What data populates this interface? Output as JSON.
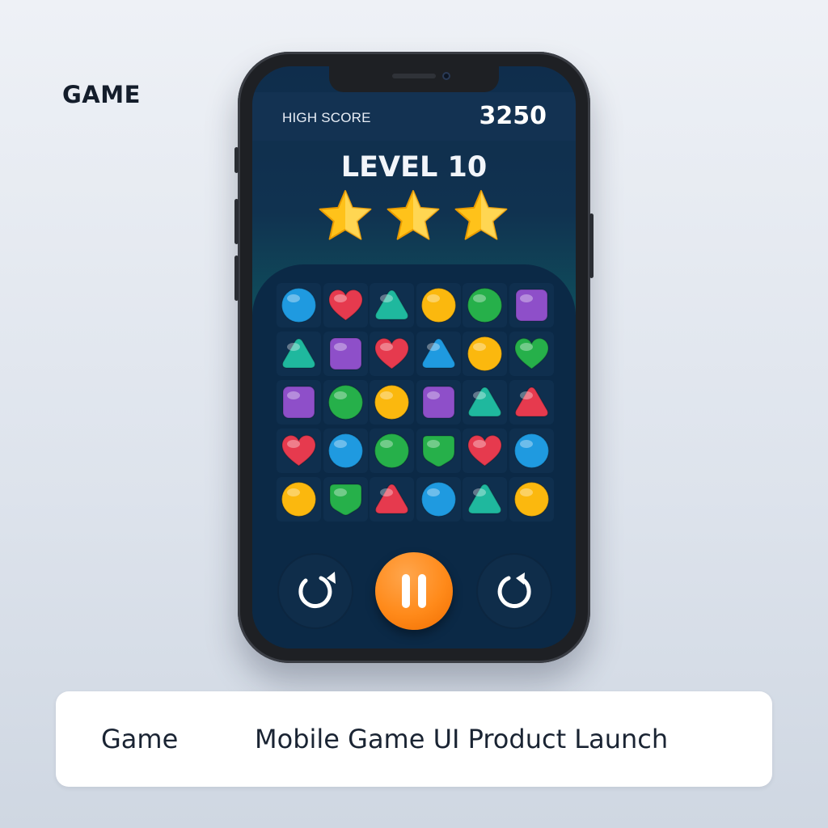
{
  "corner_label": "GAME",
  "hud": {
    "high_score_label": "HIGH SCORE",
    "high_score_value": "3250",
    "level_label": "LEVEL 10",
    "stars_earned": 3,
    "stars_total": 3
  },
  "board": {
    "rows": [
      [
        "blue-circle",
        "red-heart",
        "teal-triangle",
        "yellow-circle",
        "green-circle",
        "purple-square"
      ],
      [
        "teal-triangle",
        "purple-square",
        "red-heart",
        "blue-triangle",
        "yellow-circle",
        "green-heart"
      ],
      [
        "purple-square",
        "green-circle",
        "yellow-circle",
        "purple-square",
        "teal-triangle",
        "red-triangle"
      ],
      [
        "red-heart",
        "blue-circle",
        "green-circle",
        "green-shield",
        "red-heart",
        "blue-circle"
      ],
      [
        "yellow-circle",
        "green-shield",
        "red-triangle",
        "blue-circle",
        "teal-triangle",
        "yellow-circle"
      ]
    ],
    "colors": {
      "blue": "#1f9ae0",
      "red": "#e63a4e",
      "teal": "#1fb89e",
      "yellow": "#fbb80e",
      "green": "#26b04a",
      "purple": "#8e4fc9"
    }
  },
  "controls": {
    "restart_icon": "undo-icon",
    "pause_icon": "pause-icon",
    "redo_icon": "redo-icon",
    "accent": "#ff8a1a"
  },
  "banner": {
    "category": "Game",
    "title": "Mobile Game UI Product Launch"
  }
}
